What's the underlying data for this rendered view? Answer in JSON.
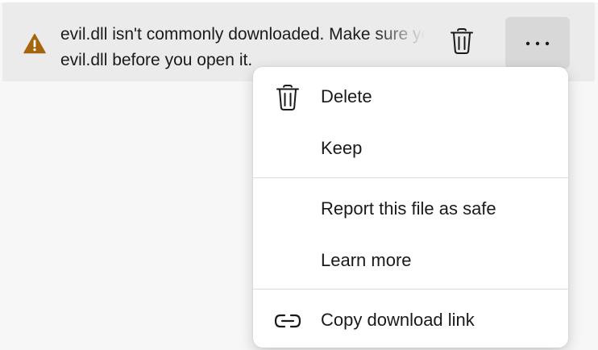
{
  "download": {
    "message_line1": "evil.dll isn't commonly downloaded. Make sure you trust",
    "message_line2": "evil.dll before you open it.",
    "icons": {
      "warning": "warning-triangle-icon",
      "delete": "trash-icon",
      "more": "more-horizontal-icon"
    },
    "colors": {
      "warning": "#a5650d",
      "item_background": "#ebebeb",
      "more_button_background": "#d8d8d8"
    }
  },
  "context_menu": {
    "items": [
      {
        "label": "Delete",
        "icon": "trash-icon"
      },
      {
        "label": "Keep",
        "icon": ""
      },
      {
        "label": "Report this file as safe",
        "icon": ""
      },
      {
        "label": "Learn more",
        "icon": ""
      },
      {
        "label": "Copy download link",
        "icon": "link-icon"
      }
    ]
  }
}
